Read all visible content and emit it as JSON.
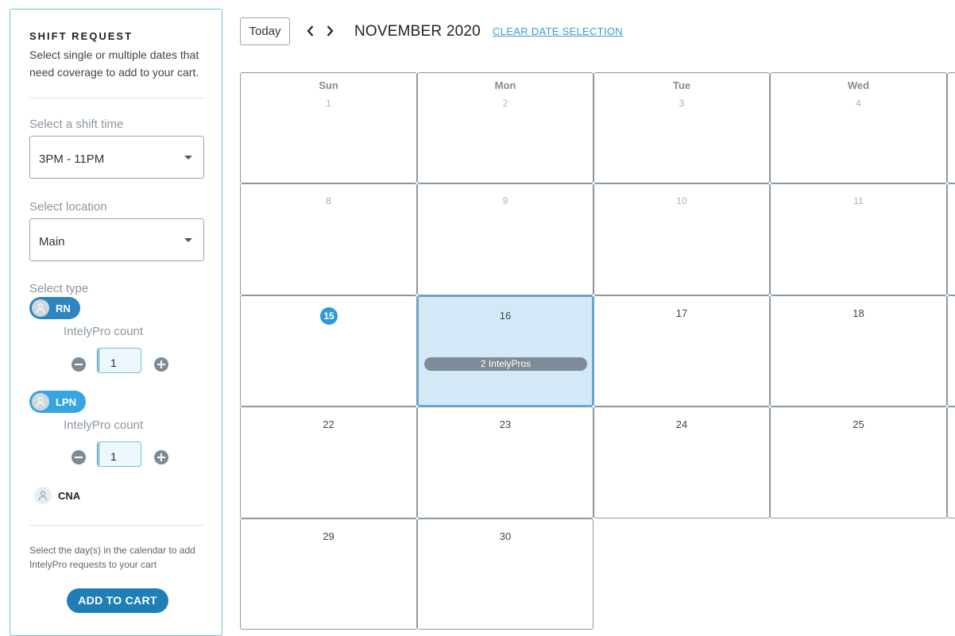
{
  "sidebar": {
    "title": "SHIFT REQUEST",
    "description": "Select single or multiple dates that need coverage to add to your cart.",
    "shift_time": {
      "label": "Select a shift time",
      "value": "3PM - 11PM"
    },
    "location": {
      "label": "Select location",
      "value": "Main"
    },
    "type_label": "Select type",
    "types": [
      {
        "name": "RN",
        "count_label": "IntelyPro count",
        "count": "1"
      },
      {
        "name": "LPN",
        "count_label": "IntelyPro count",
        "count": "1"
      },
      {
        "name": "CNA"
      }
    ],
    "hint": "Select the day(s) in the calendar to add IntelyPro requests to your cart",
    "add_to_cart": "ADD TO CART"
  },
  "header": {
    "today_label": "Today",
    "month_title": "NOVEMBER 2020",
    "clear_link": "CLEAR DATE SELECTION"
  },
  "calendar": {
    "weekdays": [
      "Sun",
      "Mon",
      "Tue",
      "Wed"
    ],
    "weeks": [
      [
        "1",
        "2",
        "3",
        "4"
      ],
      [
        "8",
        "9",
        "10",
        "11"
      ],
      [
        "15",
        "16",
        "17",
        "18"
      ],
      [
        "22",
        "23",
        "24",
        "25"
      ],
      [
        "29",
        "30"
      ]
    ],
    "today": "15",
    "selected": "16",
    "event_label": "2 IntelyPros"
  },
  "colors": {
    "accent": "#2f9ad8",
    "selected_bg": "#d3e9f8",
    "button": "#1f7fb4",
    "border": "#6ec3cd"
  }
}
